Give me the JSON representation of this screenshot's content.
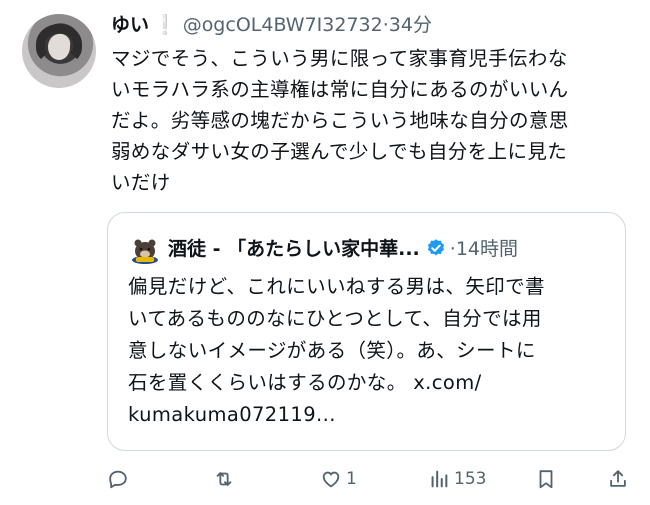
{
  "tweet": {
    "display_name": "ゆい",
    "badge": "❕",
    "handle": "@ogcOL4BW7I32732",
    "separator": "·",
    "time": "34分",
    "lines": [
      "マジでそう、こういう男に限って家事育児手伝わな",
      "いモラハラ系の主導権は常に自分にあるのがいいん",
      "だよ。劣等感の塊だからこういう地味な自分の意思",
      "弱めなダサい女の子選んで少しでも自分を上に見た",
      "いだけ"
    ]
  },
  "quote": {
    "display_name": "酒徒 - 「あたらしい家中華...",
    "verified_color": "#1d9bf0",
    "separator": "·",
    "time": "14時間",
    "lines": [
      "偏見だけど、これにいいねする男は、矢印で書",
      "いてあるもののなにひとつとして、自分では用",
      "意しないイメージがある（笑）。あ、シートに",
      "石を置くくらいはするのかな。 x.com/",
      "kumakuma072119..."
    ]
  },
  "actions": {
    "reply_icon": "reply-icon",
    "retweet_icon": "retweet-icon",
    "like_icon": "heart-icon",
    "like_count": "1",
    "views_icon": "views-icon",
    "views_count": "153",
    "bookmark_icon": "bookmark-icon",
    "share_icon": "share-icon"
  }
}
